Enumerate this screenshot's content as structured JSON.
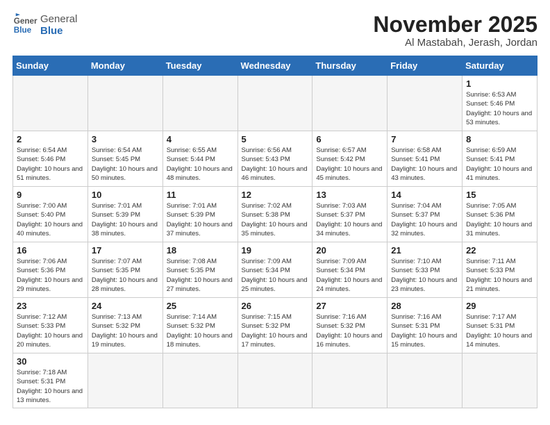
{
  "logo": {
    "text_general": "General",
    "text_blue": "Blue"
  },
  "title": "November 2025",
  "location": "Al Mastabah, Jerash, Jordan",
  "weekdays": [
    "Sunday",
    "Monday",
    "Tuesday",
    "Wednesday",
    "Thursday",
    "Friday",
    "Saturday"
  ],
  "weeks": [
    [
      {
        "day": "",
        "info": "",
        "empty": true
      },
      {
        "day": "",
        "info": "",
        "empty": true
      },
      {
        "day": "",
        "info": "",
        "empty": true
      },
      {
        "day": "",
        "info": "",
        "empty": true
      },
      {
        "day": "",
        "info": "",
        "empty": true
      },
      {
        "day": "",
        "info": "",
        "empty": true
      },
      {
        "day": "1",
        "info": "Sunrise: 6:53 AM\nSunset: 5:46 PM\nDaylight: 10 hours\nand 53 minutes."
      }
    ],
    [
      {
        "day": "2",
        "info": "Sunrise: 6:54 AM\nSunset: 5:46 PM\nDaylight: 10 hours\nand 51 minutes."
      },
      {
        "day": "3",
        "info": "Sunrise: 6:54 AM\nSunset: 5:45 PM\nDaylight: 10 hours\nand 50 minutes."
      },
      {
        "day": "4",
        "info": "Sunrise: 6:55 AM\nSunset: 5:44 PM\nDaylight: 10 hours\nand 48 minutes."
      },
      {
        "day": "5",
        "info": "Sunrise: 6:56 AM\nSunset: 5:43 PM\nDaylight: 10 hours\nand 46 minutes."
      },
      {
        "day": "6",
        "info": "Sunrise: 6:57 AM\nSunset: 5:42 PM\nDaylight: 10 hours\nand 45 minutes."
      },
      {
        "day": "7",
        "info": "Sunrise: 6:58 AM\nSunset: 5:41 PM\nDaylight: 10 hours\nand 43 minutes."
      },
      {
        "day": "8",
        "info": "Sunrise: 6:59 AM\nSunset: 5:41 PM\nDaylight: 10 hours\nand 41 minutes."
      }
    ],
    [
      {
        "day": "9",
        "info": "Sunrise: 7:00 AM\nSunset: 5:40 PM\nDaylight: 10 hours\nand 40 minutes."
      },
      {
        "day": "10",
        "info": "Sunrise: 7:01 AM\nSunset: 5:39 PM\nDaylight: 10 hours\nand 38 minutes."
      },
      {
        "day": "11",
        "info": "Sunrise: 7:01 AM\nSunset: 5:39 PM\nDaylight: 10 hours\nand 37 minutes."
      },
      {
        "day": "12",
        "info": "Sunrise: 7:02 AM\nSunset: 5:38 PM\nDaylight: 10 hours\nand 35 minutes."
      },
      {
        "day": "13",
        "info": "Sunrise: 7:03 AM\nSunset: 5:37 PM\nDaylight: 10 hours\nand 34 minutes."
      },
      {
        "day": "14",
        "info": "Sunrise: 7:04 AM\nSunset: 5:37 PM\nDaylight: 10 hours\nand 32 minutes."
      },
      {
        "day": "15",
        "info": "Sunrise: 7:05 AM\nSunset: 5:36 PM\nDaylight: 10 hours\nand 31 minutes."
      }
    ],
    [
      {
        "day": "16",
        "info": "Sunrise: 7:06 AM\nSunset: 5:36 PM\nDaylight: 10 hours\nand 29 minutes."
      },
      {
        "day": "17",
        "info": "Sunrise: 7:07 AM\nSunset: 5:35 PM\nDaylight: 10 hours\nand 28 minutes."
      },
      {
        "day": "18",
        "info": "Sunrise: 7:08 AM\nSunset: 5:35 PM\nDaylight: 10 hours\nand 27 minutes."
      },
      {
        "day": "19",
        "info": "Sunrise: 7:09 AM\nSunset: 5:34 PM\nDaylight: 10 hours\nand 25 minutes."
      },
      {
        "day": "20",
        "info": "Sunrise: 7:09 AM\nSunset: 5:34 PM\nDaylight: 10 hours\nand 24 minutes."
      },
      {
        "day": "21",
        "info": "Sunrise: 7:10 AM\nSunset: 5:33 PM\nDaylight: 10 hours\nand 23 minutes."
      },
      {
        "day": "22",
        "info": "Sunrise: 7:11 AM\nSunset: 5:33 PM\nDaylight: 10 hours\nand 21 minutes."
      }
    ],
    [
      {
        "day": "23",
        "info": "Sunrise: 7:12 AM\nSunset: 5:33 PM\nDaylight: 10 hours\nand 20 minutes."
      },
      {
        "day": "24",
        "info": "Sunrise: 7:13 AM\nSunset: 5:32 PM\nDaylight: 10 hours\nand 19 minutes."
      },
      {
        "day": "25",
        "info": "Sunrise: 7:14 AM\nSunset: 5:32 PM\nDaylight: 10 hours\nand 18 minutes."
      },
      {
        "day": "26",
        "info": "Sunrise: 7:15 AM\nSunset: 5:32 PM\nDaylight: 10 hours\nand 17 minutes."
      },
      {
        "day": "27",
        "info": "Sunrise: 7:16 AM\nSunset: 5:32 PM\nDaylight: 10 hours\nand 16 minutes."
      },
      {
        "day": "28",
        "info": "Sunrise: 7:16 AM\nSunset: 5:31 PM\nDaylight: 10 hours\nand 15 minutes."
      },
      {
        "day": "29",
        "info": "Sunrise: 7:17 AM\nSunset: 5:31 PM\nDaylight: 10 hours\nand 14 minutes."
      }
    ],
    [
      {
        "day": "30",
        "info": "Sunrise: 7:18 AM\nSunset: 5:31 PM\nDaylight: 10 hours\nand 13 minutes."
      },
      {
        "day": "",
        "info": "",
        "empty": true
      },
      {
        "day": "",
        "info": "",
        "empty": true
      },
      {
        "day": "",
        "info": "",
        "empty": true
      },
      {
        "day": "",
        "info": "",
        "empty": true
      },
      {
        "day": "",
        "info": "",
        "empty": true
      },
      {
        "day": "",
        "info": "",
        "empty": true
      }
    ]
  ]
}
